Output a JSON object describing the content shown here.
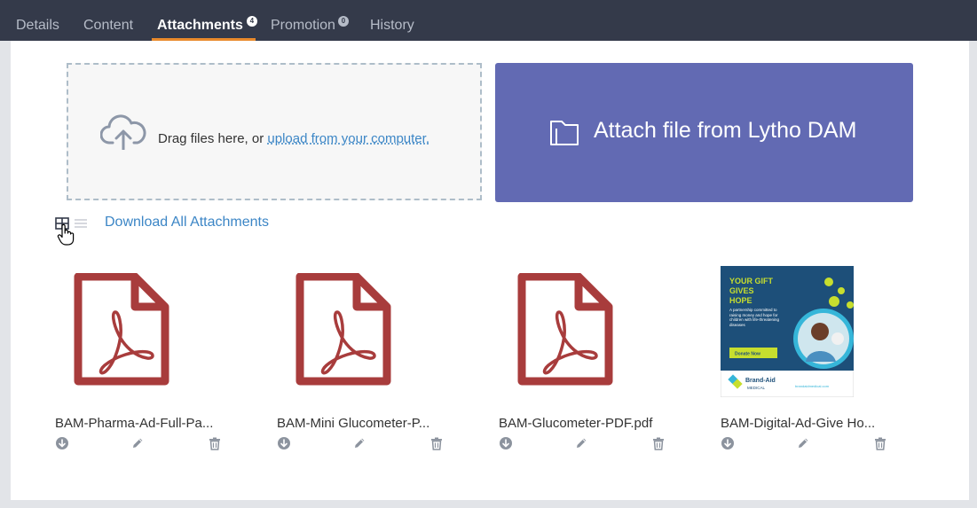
{
  "tabs": [
    {
      "label": "Details",
      "badge": ""
    },
    {
      "label": "Content",
      "badge": ""
    },
    {
      "label": "Attachments",
      "badge": "4"
    },
    {
      "label": "Promotion",
      "badge": "0"
    },
    {
      "label": "History",
      "badge": ""
    }
  ],
  "active_tab": "Attachments",
  "dropzone": {
    "text": "Drag files here, or ",
    "link": "upload from your computer."
  },
  "dam_button": {
    "label": "Attach file from Lytho DAM",
    "icon": "folder-icon"
  },
  "download_all": "Download All Attachments",
  "view_toggle": {
    "selected": "grid",
    "icons": [
      "grid-view-icon",
      "list-view-icon"
    ]
  },
  "attachments": [
    {
      "name": "BAM-Pharma-Ad-Full-Pa...",
      "type": "pdf"
    },
    {
      "name": "BAM-Mini Glucometer-P...",
      "type": "pdf"
    },
    {
      "name": "BAM-Glucometer-PDF.pdf",
      "type": "pdf"
    },
    {
      "name": "BAM-Digital-Ad-Give Ho...",
      "type": "image",
      "preview": {
        "headline": [
          "YOUR GIFT",
          "GIVES",
          "HOPE"
        ],
        "body": "A partnership committed to raising money and hope for children with life-threatening diseases",
        "cta": "Donate Now",
        "brand": "Brand-Aid",
        "brand_sub": "MEDICAL",
        "url": "brandaidmedical.com"
      }
    }
  ],
  "colors": {
    "topbar": "#343a4a",
    "accent": "#e98a2c",
    "dam_button": "#626ab3",
    "pdf_icon": "#a83c3c",
    "link": "#3c86c6"
  }
}
